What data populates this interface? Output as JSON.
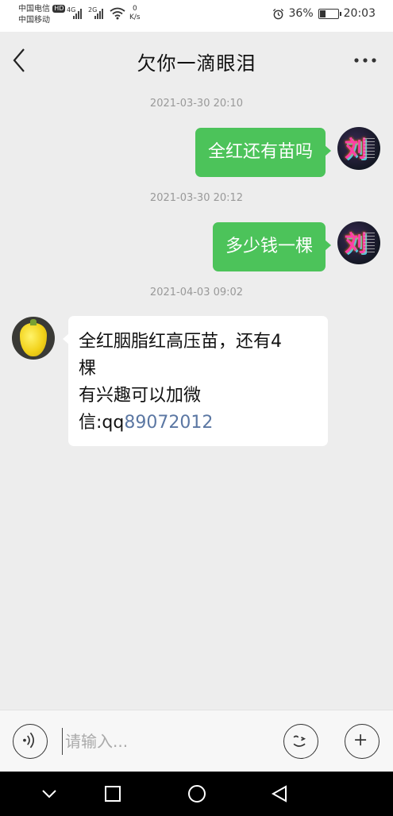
{
  "status_bar": {
    "carrier_1": "中国电信",
    "hd_badge": "HD",
    "carrier_2": "中国移动",
    "sig1_label": "4G",
    "sig2_label": "2G",
    "net_speed_value": "0",
    "net_speed_unit": "K/s",
    "battery_percent": "36%",
    "battery_level": 0.36,
    "time": "20:03"
  },
  "header": {
    "back_icon": "chevron-left-icon",
    "title": "欠你一滴眼泪",
    "more_icon": "more-dots-icon"
  },
  "messages": [
    {
      "timestamp": "2021-03-30 20:10",
      "direction": "out",
      "text": "全红还有苗吗"
    },
    {
      "timestamp": "2021-03-30 20:12",
      "direction": "out",
      "text": "多少钱一棵"
    },
    {
      "timestamp": "2021-04-03 09:02",
      "direction": "in",
      "lines": [
        "全红胭脂红高压苗，还有4",
        "棵",
        "有兴趣可以加微"
      ],
      "last_line_prefix": "信:qq",
      "last_line_link": "89072012"
    }
  ],
  "avatar_me_glyph": "刘",
  "input_bar": {
    "placeholder": "请输入...",
    "voice_icon": "voice-icon",
    "emoji_icon": "emoji-icon",
    "plus_icon": "plus-icon"
  },
  "colors": {
    "outgoing_bubble": "#4cc35a",
    "incoming_bubble": "#ffffff",
    "chat_background": "#ededed",
    "link": "#5b77a3"
  }
}
